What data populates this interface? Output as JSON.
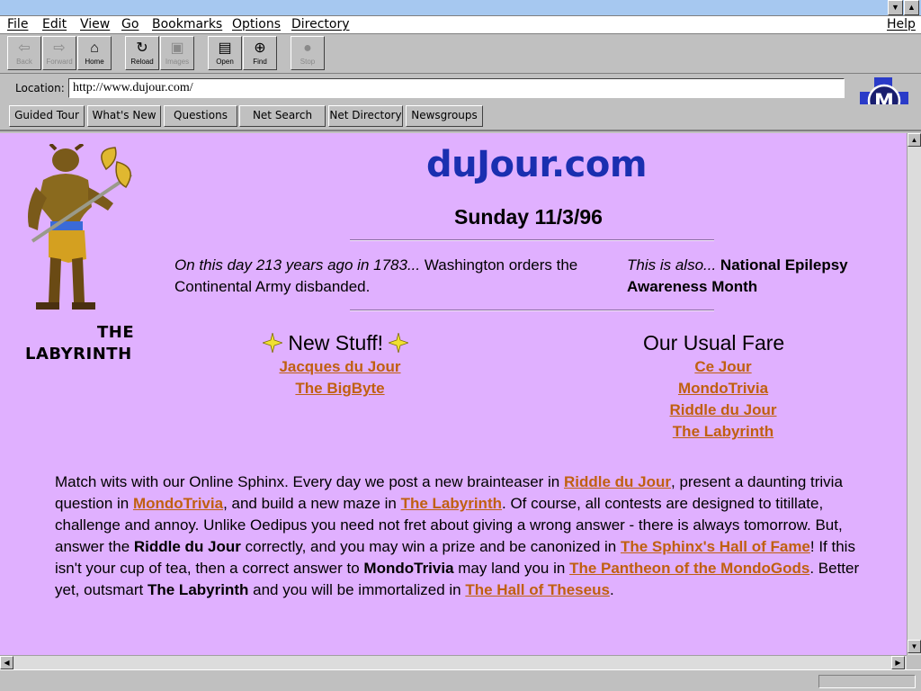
{
  "menu": [
    "File",
    "Edit",
    "View",
    "Go",
    "Bookmarks",
    "Options",
    "Directory"
  ],
  "menu_help": "Help",
  "toolbar": [
    {
      "label": "Back",
      "icon": "back-arrow-icon",
      "glyph": "⇦",
      "enabled": false
    },
    {
      "label": "Forward",
      "icon": "forward-arrow-icon",
      "glyph": "⇨",
      "enabled": false
    },
    {
      "label": "Home",
      "icon": "home-icon",
      "glyph": "⌂",
      "enabled": true
    },
    {
      "label": "Reload",
      "icon": "reload-icon",
      "glyph": "↻",
      "enabled": true
    },
    {
      "label": "Images",
      "icon": "images-icon",
      "glyph": "▣",
      "enabled": false
    },
    {
      "label": "Open",
      "icon": "open-icon",
      "glyph": "▤",
      "enabled": true
    },
    {
      "label": "Find",
      "icon": "find-binoculars-icon",
      "glyph": "⊕",
      "enabled": true
    },
    {
      "label": "Stop",
      "icon": "stop-icon",
      "glyph": "●",
      "enabled": false
    }
  ],
  "location": {
    "label": "Location:",
    "url": "http://www.dujour.com/"
  },
  "directory_buttons": [
    "Guided Tour",
    "What's New",
    "Questions",
    "Net Search",
    "Net Directory",
    "Newsgroups"
  ],
  "logo_letter": "M",
  "page": {
    "brand": "duJour.com",
    "date": "Sunday 11/3/96",
    "labyrinth_line1": "THE",
    "labyrinth_line2": "LABYRINTH",
    "history_italic": "On this day 213 years ago in 1783...",
    "history_rest": " Washington orders the Continental Army disbanded.",
    "also_italic": "This is also...",
    "also_bold": " National Epilepsy Awareness Month",
    "new_stuff_title": "New Stuff!",
    "new_stuff_links": [
      "Jacques du Jour",
      "The BigByte"
    ],
    "usual_fare_title": "Our Usual Fare",
    "usual_fare_links": [
      "Ce Jour",
      "MondoTrivia",
      "Riddle du Jour",
      "The Labyrinth"
    ],
    "body": [
      {
        "t": "Match wits with our Online Sphinx. Every day we post a new brainteaser in "
      },
      {
        "l": "Riddle du Jour"
      },
      {
        "t": ", present a daunting trivia question in "
      },
      {
        "l": "MondoTrivia"
      },
      {
        "t": ", and build a new maze in "
      },
      {
        "l": "The Labyrinth"
      },
      {
        "t": ". Of course, all contests are designed to titillate, challenge and annoy. Unlike Oedipus you need not fret about giving a wrong answer - there is always tomorrow. But, answer the "
      },
      {
        "b": "Riddle du Jour"
      },
      {
        "t": " correctly, and you may win a prize and be canonized in "
      },
      {
        "l": "The Sphinx's Hall of Fame"
      },
      {
        "t": "! If this isn't your cup of tea, then a correct answer to "
      },
      {
        "b": "MondoTrivia"
      },
      {
        "t": " may land you in "
      },
      {
        "l": "The Pantheon of the MondoGods"
      },
      {
        "t": ". Better yet, outsmart "
      },
      {
        "b": "The Labyrinth"
      },
      {
        "t": " and you will be immortalized in "
      },
      {
        "l": "The Hall of Theseus"
      },
      {
        "t": "."
      }
    ]
  },
  "colors": {
    "page_bg": "#e0b0ff",
    "link": "#c06010",
    "brand": "#1a2fb0"
  }
}
